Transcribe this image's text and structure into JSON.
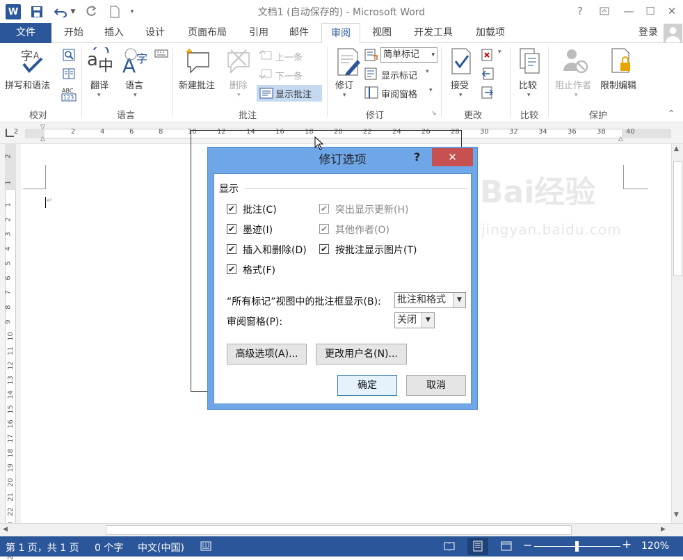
{
  "window": {
    "title": "文档1 (自动保存的) - Microsoft Word",
    "help": "?",
    "login": "登录"
  },
  "tabs": [
    "文件",
    "开始",
    "插入",
    "设计",
    "页面布局",
    "引用",
    "邮件",
    "审阅",
    "视图",
    "开发工具",
    "加载项"
  ],
  "ribbon": {
    "proofing": {
      "spelling": "拼写和语法",
      "group": "校对"
    },
    "language": {
      "translate": "翻译",
      "language": "语言",
      "group": "语言"
    },
    "comments": {
      "new": "新建批注",
      "delete": "删除",
      "prev": "上一条",
      "next": "下一条",
      "show": "显示批注",
      "group": "批注"
    },
    "tracking": {
      "track": "修订",
      "markup_select": "简单标记",
      "show_markup": "显示标记",
      "review_pane": "审阅窗格",
      "group": "修订"
    },
    "changes": {
      "accept": "接受",
      "group": "更改"
    },
    "compare": {
      "compare": "比较",
      "group": "比较"
    },
    "protect": {
      "block": "阻止作者",
      "restrict": "限制编辑",
      "group": "保护"
    }
  },
  "ruler": {
    "ticks": [
      "2",
      "2",
      "4",
      "6",
      "8",
      "10",
      "12",
      "14",
      "16",
      "18",
      "20",
      "22",
      "24",
      "26",
      "28",
      "30",
      "32",
      "34",
      "36",
      "38",
      "40"
    ]
  },
  "vruler": {
    "ticks": [
      "2",
      "1",
      "1",
      "2",
      "3",
      "4",
      "5",
      "6",
      "7",
      "8",
      "9",
      "10",
      "11",
      "12",
      "13",
      "14",
      "15",
      "16",
      "17",
      "18",
      "19",
      "20",
      "21",
      "22",
      "23",
      "24",
      "25"
    ]
  },
  "dialog": {
    "title": "修订选项",
    "help": "?",
    "close": "✕",
    "section": "显示",
    "checks": {
      "comments": "批注(C)",
      "ink": "墨迹(I)",
      "insert_delete": "插入和删除(D)",
      "format": "格式(F)",
      "highlight_updates": "突出显示更新(H)",
      "other_authors": "其他作者(O)",
      "pictures_by_comment": "按批注显示图片(T)"
    },
    "balloon_label": "“所有标记”视图中的批注框显示(B):",
    "balloon_value": "批注和格式",
    "pane_label": "审阅窗格(P):",
    "pane_value": "关闭",
    "advanced": "高级选项(A)...",
    "change_user": "更改用户名(N)...",
    "ok": "确定",
    "cancel": "取消"
  },
  "status": {
    "page": "第 1 页，共 1 页",
    "words": "0 个字",
    "lang": "中文(中国)",
    "zoom": "120%"
  },
  "watermark": {
    "text": "Bai经验",
    "url": "jingyan.baidu.com"
  }
}
